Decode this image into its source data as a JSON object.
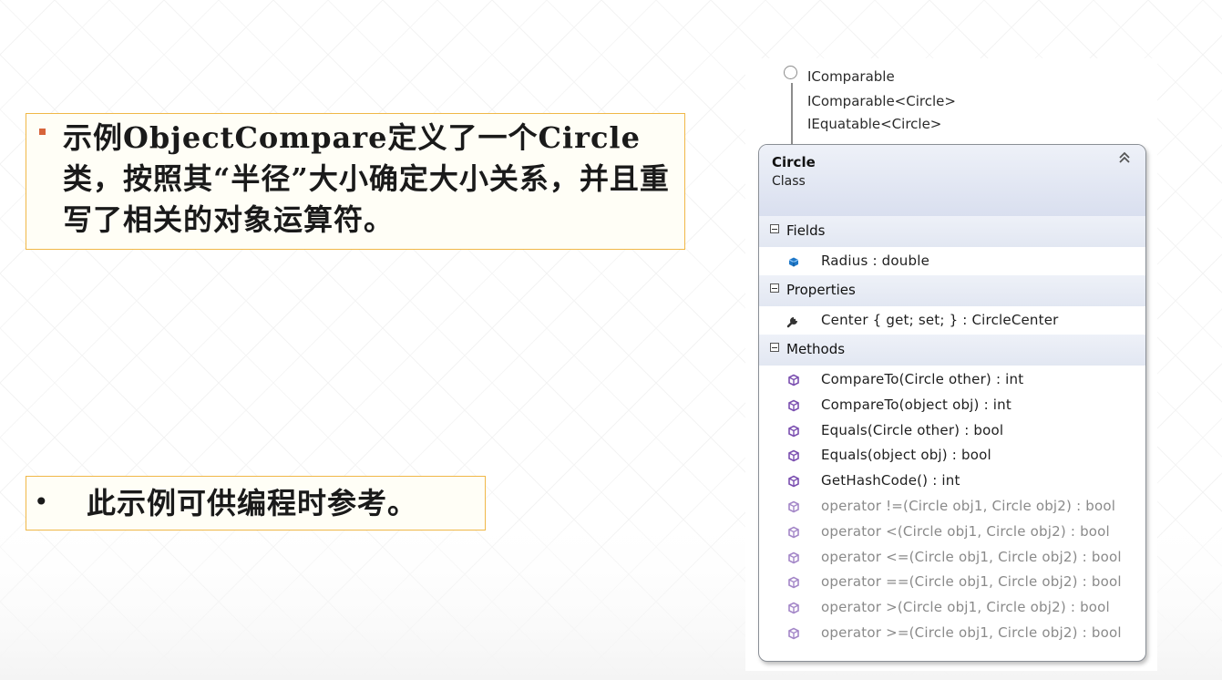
{
  "slide": {
    "callout_1_text": "示例ObjectCompare定义了一个Circle类，按照其“半径”大小确定大小关系，并且重写了相关的对象运算符。",
    "callout_2_bullet": "•",
    "callout_2_text": "此示例可供编程时参考。"
  },
  "diagram": {
    "interfaces": [
      "IComparable",
      "IComparable<Circle>",
      "IEquatable<Circle>"
    ],
    "class_name": "Circle",
    "class_kind": "Class",
    "collapse_icon": "⌃",
    "sections": {
      "fields_label": "Fields",
      "properties_label": "Properties",
      "methods_label": "Methods"
    },
    "fields": [
      {
        "text": "Radius : double",
        "icon": "field-icon"
      }
    ],
    "properties": [
      {
        "text": "Center { get; set; } : CircleCenter",
        "icon": "property-icon"
      }
    ],
    "methods": [
      {
        "text": "CompareTo(Circle other) : int",
        "icon": "method-icon"
      },
      {
        "text": "CompareTo(object obj) : int",
        "icon": "method-icon"
      },
      {
        "text": "Equals(Circle other) : bool",
        "icon": "method-icon"
      },
      {
        "text": "Equals(object obj) : bool",
        "icon": "method-icon"
      },
      {
        "text": "GetHashCode() : int",
        "icon": "method-icon"
      },
      {
        "text": "operator !=(Circle obj1, Circle obj2) : bool",
        "icon": "static-method-icon"
      },
      {
        "text": "operator <(Circle obj1, Circle obj2) : bool",
        "icon": "static-method-icon"
      },
      {
        "text": "operator <=(Circle obj1, Circle obj2) : bool",
        "icon": "static-method-icon"
      },
      {
        "text": "operator ==(Circle obj1, Circle obj2) : bool",
        "icon": "static-method-icon"
      },
      {
        "text": "operator >(Circle obj1, Circle obj2) : bool",
        "icon": "static-method-icon"
      },
      {
        "text": "operator >=(Circle obj1, Circle obj2) : bool",
        "icon": "static-method-icon"
      }
    ]
  },
  "colors": {
    "callout_border": "#f0b848",
    "bullet_square": "#d7643a",
    "header_gradient_top": "#eef1f8",
    "header_gradient_bottom": "#d9dfef",
    "method_icon": "#7b4fb0",
    "field_icon": "#1f78c8"
  }
}
